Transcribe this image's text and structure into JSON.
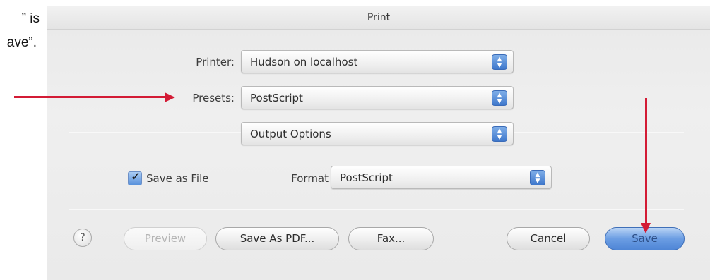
{
  "caption": {
    "line1": "” is",
    "line2": "ave”."
  },
  "dialog": {
    "title": "Print",
    "printer": {
      "label": "Printer:",
      "value": "Hudson on localhost"
    },
    "presets": {
      "label": "Presets:",
      "value": "PostScript"
    },
    "panel": {
      "value": "Output Options"
    },
    "save_as_file": {
      "checked": true,
      "label": "Save as File"
    },
    "format": {
      "label": "Format",
      "value": "PostScript"
    },
    "buttons": {
      "help": "?",
      "preview": "Preview",
      "save_as_pdf": "Save As PDF...",
      "fax": "Fax...",
      "cancel": "Cancel",
      "save": "Save"
    }
  },
  "annotations": {
    "arrow_color": "#d31b35"
  },
  "colors": {
    "accent": "#4f86d6",
    "window_bg": "#ececec"
  }
}
